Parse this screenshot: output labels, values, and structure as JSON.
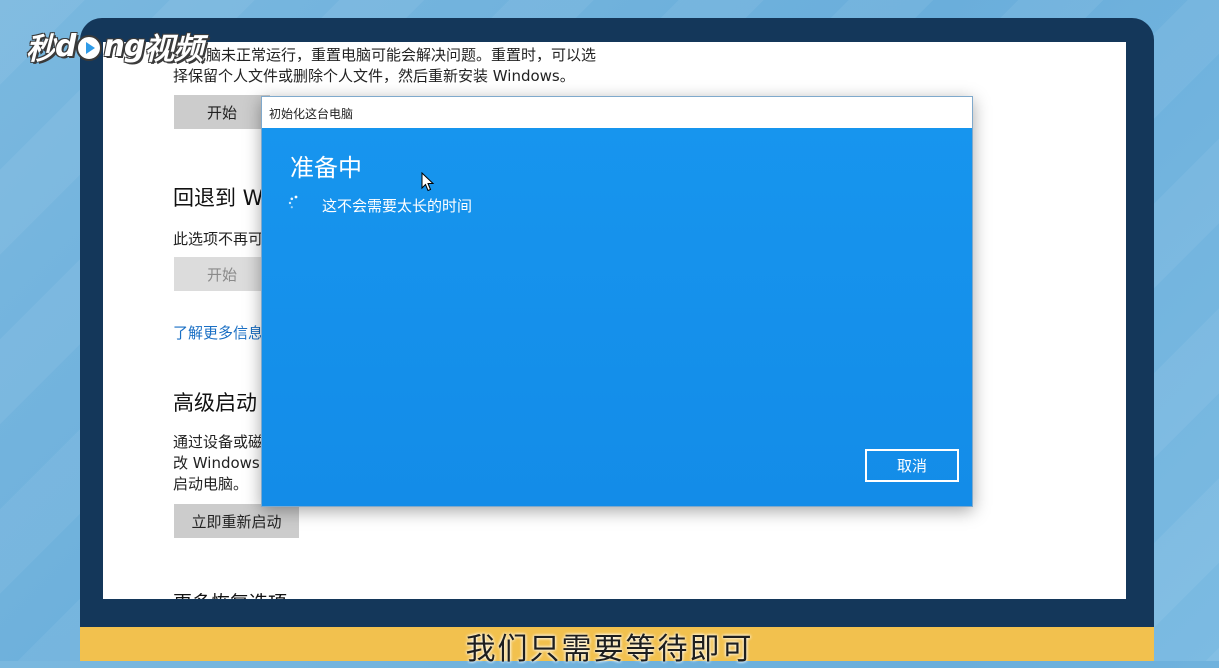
{
  "logo": {
    "part1": "秒",
    "part2": "ng",
    "part3": "视频",
    "letter_d": "d"
  },
  "settings": {
    "reset_desc_line1": "电脑未正常运行，重置电脑可能会解决问题。重置时，可以选",
    "reset_desc_line2": "择保留个人文件或删除个人文件，然后重新安装 Windows。",
    "reset_start_button": "开始",
    "goback_heading": "回退到 W",
    "goback_desc": "此选项不再可",
    "goback_start_button": "开始",
    "learn_more_link": "了解更多信息",
    "advanced_heading": "高级启动",
    "advanced_desc_line1": "通过设备或磁",
    "advanced_desc_line2": "改 Windows",
    "advanced_desc_line3": "启动电脑。",
    "restart_now_button": "立即重新启动",
    "more_recovery_heading": "更多恢复选项"
  },
  "dialog": {
    "title": "初始化这台电脑",
    "heading": "准备中",
    "message": "这不会需要太长的时间",
    "cancel_button": "取消"
  },
  "subtitle": "我们只需要等待即可",
  "colors": {
    "dialog_blue": "#1592ec",
    "accent_yellow": "#f2c14e",
    "monitor_frame": "#14375a"
  }
}
